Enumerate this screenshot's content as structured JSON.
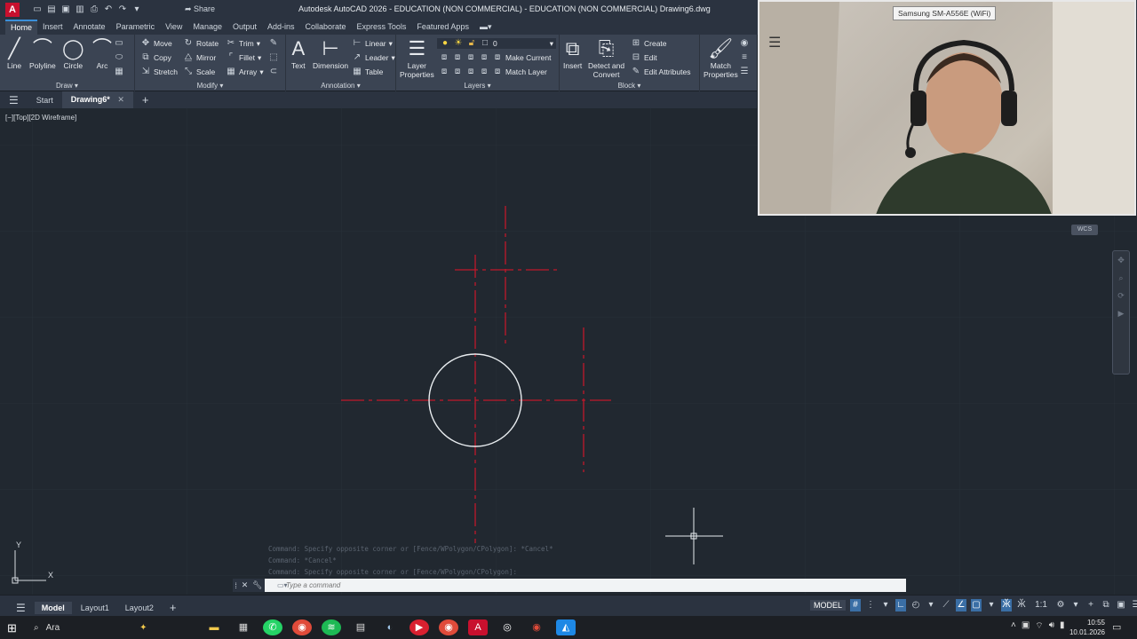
{
  "app": {
    "logo_letter": "A",
    "window_title": "Autodesk AutoCAD 2026 - EDUCATION (NON COMMERCIAL) - EDUCATION (NON COMMERCIAL)    Drawing6.dwg",
    "share_label": "Share"
  },
  "ribbon_tabs": [
    "Home",
    "Insert",
    "Annotate",
    "Parametric",
    "View",
    "Manage",
    "Output",
    "Add-ins",
    "Collaborate",
    "Express Tools",
    "Featured Apps"
  ],
  "ribbon": {
    "draw": {
      "label": "Draw",
      "line": "Line",
      "polyline": "Polyline",
      "circle": "Circle",
      "arc": "Arc"
    },
    "modify": {
      "label": "Modify",
      "move": "Move",
      "rotate": "Rotate",
      "trim": "Trim",
      "copy": "Copy",
      "mirror": "Mirror",
      "fillet": "Fillet",
      "stretch": "Stretch",
      "scale": "Scale",
      "array": "Array"
    },
    "annotation": {
      "label": "Annotation",
      "text": "Text",
      "dimension": "Dimension",
      "linear": "Linear",
      "leader": "Leader",
      "table": "Table"
    },
    "layers": {
      "label": "Layers",
      "layer_properties": "Layer\nProperties",
      "current_layer": "0",
      "make_current": "Make Current",
      "match_layer": "Match Layer"
    },
    "block": {
      "label": "Block",
      "insert": "Insert",
      "detect_convert": "Detect and\nConvert",
      "create": "Create",
      "edit": "Edit",
      "edit_attributes": "Edit Attributes"
    },
    "properties": {
      "match_properties": "Match\nProperties"
    }
  },
  "file_tabs": [
    "Start",
    "Drawing6*"
  ],
  "viewport": {
    "label": "[−][Top][2D Wireframe]",
    "wcs": "WCS",
    "ucs_x": "X",
    "ucs_y": "Y"
  },
  "command": {
    "history": [
      "Command: Specify opposite corner or [Fence/WPolygon/CPolygon]: *Cancel*",
      "Command: *Cancel*",
      "Command: Specify opposite corner or [Fence/WPolygon/CPolygon]:"
    ],
    "placeholder": "Type a command"
  },
  "status": {
    "layout_tabs": [
      "Model",
      "Layout1",
      "Layout2"
    ],
    "model_label": "MODEL",
    "scale": "1:1"
  },
  "taskbar": {
    "search_label": "Ara",
    "time": "10:55",
    "date": "10.01.2026"
  },
  "webcam": {
    "label": "Samsung SM-A556E (WiFi)"
  },
  "colors": {
    "accent": "#3a8fd8",
    "centerline": "#c0182a",
    "background": "#212830"
  }
}
